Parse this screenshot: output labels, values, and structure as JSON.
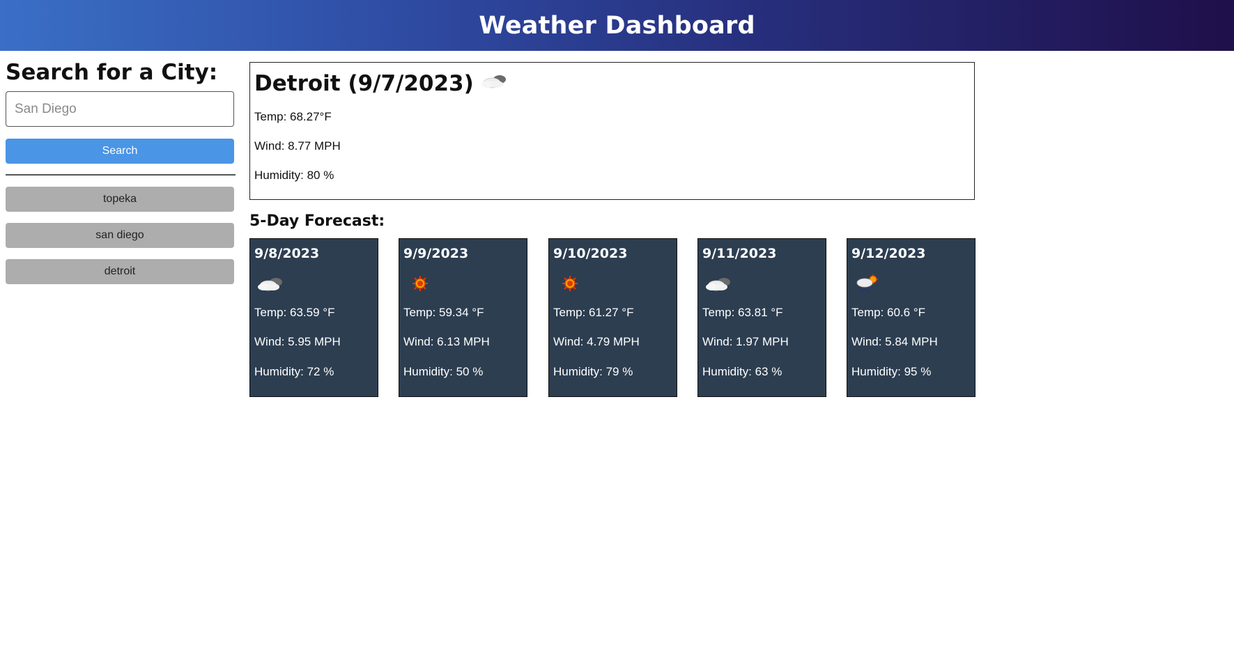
{
  "header": {
    "title": "Weather Dashboard"
  },
  "sidebar": {
    "title": "Search for a City:",
    "search_placeholder": "San Diego",
    "search_value": "",
    "search_button": "Search",
    "history": [
      {
        "label": "topeka"
      },
      {
        "label": "san diego"
      },
      {
        "label": "detroit"
      }
    ]
  },
  "current": {
    "heading": "Detroit (9/7/2023)",
    "icon": "cloud-icon",
    "temp": "Temp: 68.27°F",
    "wind": "Wind: 8.77 MPH",
    "humidity": "Humidity: 80 %"
  },
  "forecast": {
    "title": "5-Day Forecast:",
    "days": [
      {
        "date": "9/8/2023",
        "icon": "cloud-icon",
        "temp": "Temp: 63.59 °F",
        "wind": "Wind: 5.95 MPH",
        "humidity": "Humidity: 72 %"
      },
      {
        "date": "9/9/2023",
        "icon": "sun-icon",
        "temp": "Temp: 59.34 °F",
        "wind": "Wind: 6.13 MPH",
        "humidity": "Humidity: 50 %"
      },
      {
        "date": "9/10/2023",
        "icon": "sun-icon",
        "temp": "Temp: 61.27 °F",
        "wind": "Wind: 4.79 MPH",
        "humidity": "Humidity: 79 %"
      },
      {
        "date": "9/11/2023",
        "icon": "cloud-icon",
        "temp": "Temp: 63.81 °F",
        "wind": "Wind: 1.97 MPH",
        "humidity": "Humidity: 63 %"
      },
      {
        "date": "9/12/2023",
        "icon": "rain-sun-icon",
        "temp": "Temp: 60.6 °F",
        "wind": "Wind: 5.84 MPH",
        "humidity": "Humidity: 95 %"
      }
    ]
  },
  "colors": {
    "search_button": "#4a95e6",
    "history_button": "#adadad",
    "card_background": "#2d3e51"
  }
}
